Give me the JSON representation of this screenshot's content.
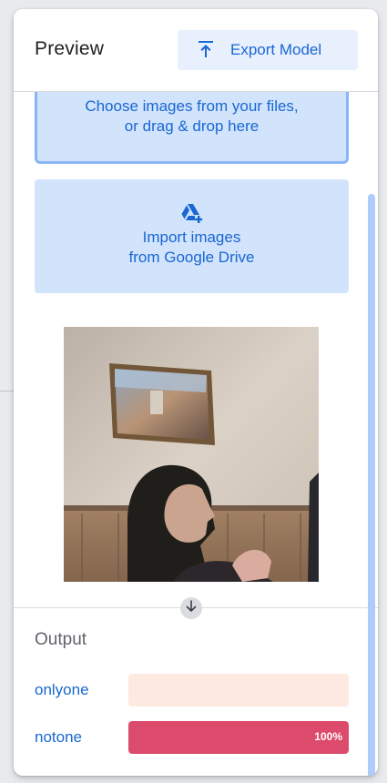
{
  "header": {
    "title": "Preview",
    "export_label": "Export Model"
  },
  "upload": {
    "choose_text": "Choose images from your files,\nor drag & drop here",
    "drive_text": "Import images\nfrom Google Drive"
  },
  "output": {
    "title": "Output",
    "classes": [
      {
        "label": "onlyone",
        "value": 0,
        "value_label": "",
        "track_color": "#fde9df",
        "fill_color": "#f4978e"
      },
      {
        "label": "notone",
        "value": 1.0,
        "value_label": "100%",
        "track_color": "#fde9df",
        "fill_color": "#dc4a6c"
      }
    ]
  },
  "colors": {
    "accent": "#1967d2",
    "button_bg": "#e8f0fe",
    "drop_bg": "#d2e3fc"
  },
  "icons": {
    "export": "upload-arrow-icon",
    "drive": "google-drive-add-icon",
    "scroll_down": "arrow-down-icon"
  }
}
